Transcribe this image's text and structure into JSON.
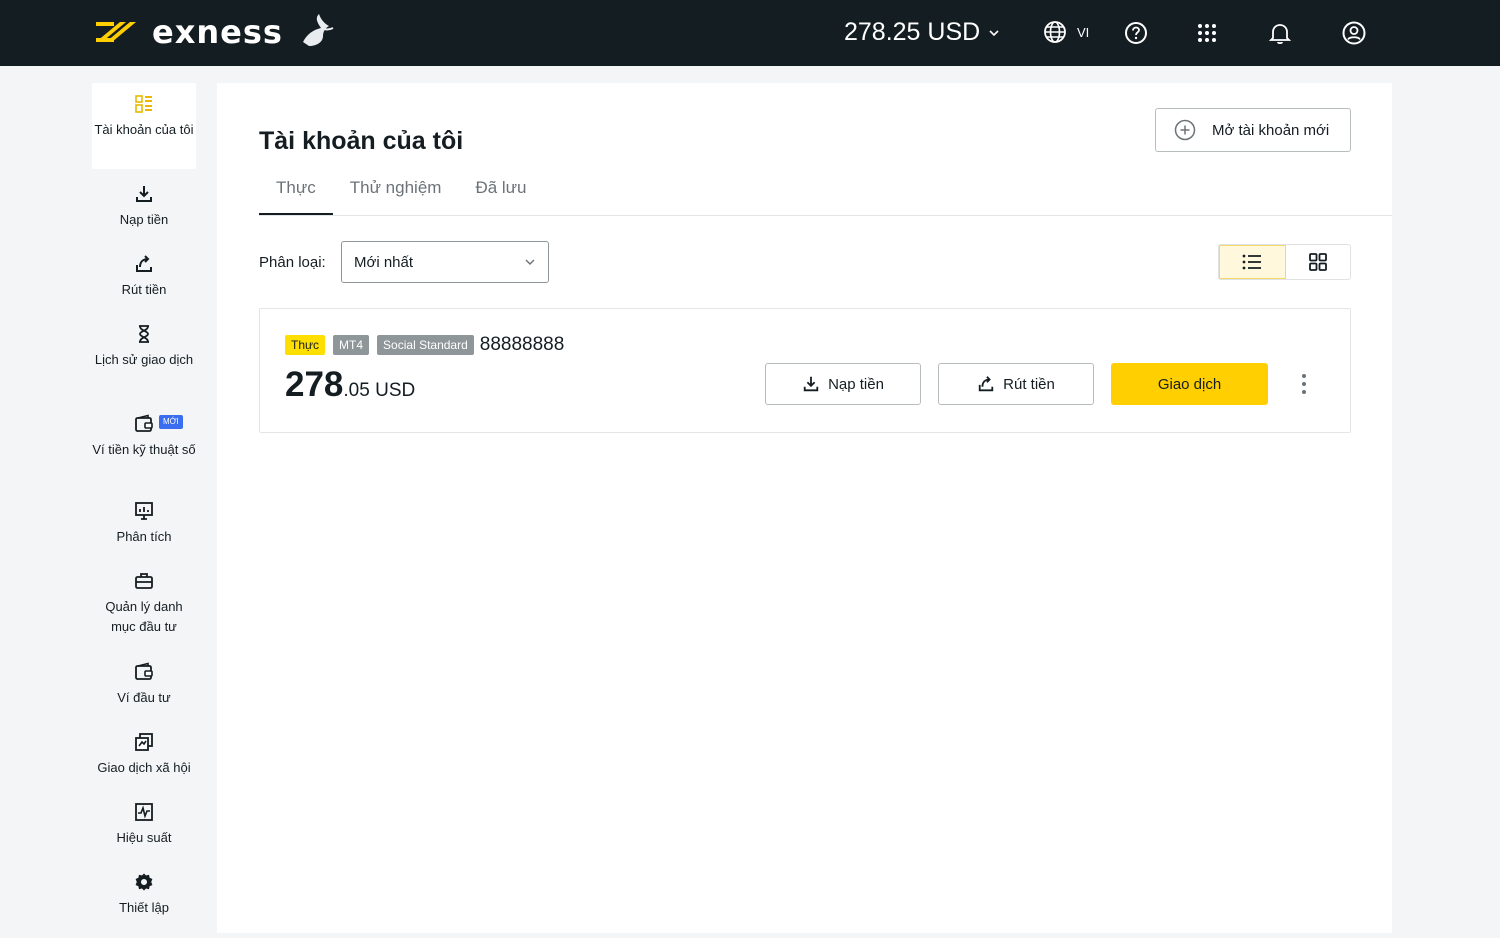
{
  "header": {
    "brand": "exness",
    "balance": "278.25 USD",
    "language": "VI"
  },
  "sidebar": {
    "items": [
      {
        "label": "Tài khoản của tôi",
        "icon": "accounts-icon",
        "active": true
      },
      {
        "label": "Nạp tiền",
        "icon": "deposit-icon"
      },
      {
        "label": "Rút tiền",
        "icon": "withdraw-icon"
      },
      {
        "label": "Lịch sử giao dịch",
        "icon": "hourglass-icon"
      },
      {
        "label": "Ví tiền kỹ thuật số",
        "icon": "wallet-icon",
        "badge": "MỚI"
      },
      {
        "label": "Phân tích",
        "icon": "analytics-icon"
      },
      {
        "label": "Quản lý danh mục đầu tư",
        "icon": "briefcase-icon"
      },
      {
        "label": "Ví đầu tư",
        "icon": "investment-wallet-icon"
      },
      {
        "label": "Giao dịch xã hội",
        "icon": "social-trading-icon"
      },
      {
        "label": "Hiệu suất",
        "icon": "performance-icon"
      },
      {
        "label": "Thiết lập",
        "icon": "settings-icon"
      }
    ]
  },
  "main": {
    "title": "Tài khoản của tôi",
    "open_account_label": "Mở tài khoản mới",
    "tabs": [
      {
        "label": "Thực",
        "active": true
      },
      {
        "label": "Thử nghiệm"
      },
      {
        "label": "Đã lưu"
      }
    ],
    "sort": {
      "label": "Phân loại:",
      "value": "Mới nhất"
    },
    "view_mode": "list"
  },
  "account": {
    "badges": [
      "Thực",
      "MT4",
      "Social Standard"
    ],
    "number": "88888888",
    "balance_int": "278",
    "balance_dec": ".05 USD",
    "deposit_label": "Nạp tiền",
    "withdraw_label": "Rút tiền",
    "trade_label": "Giao dịch"
  },
  "colors": {
    "header_bg": "#141d22",
    "accent": "#ffcf01",
    "badge_blue": "#3a6df0"
  }
}
